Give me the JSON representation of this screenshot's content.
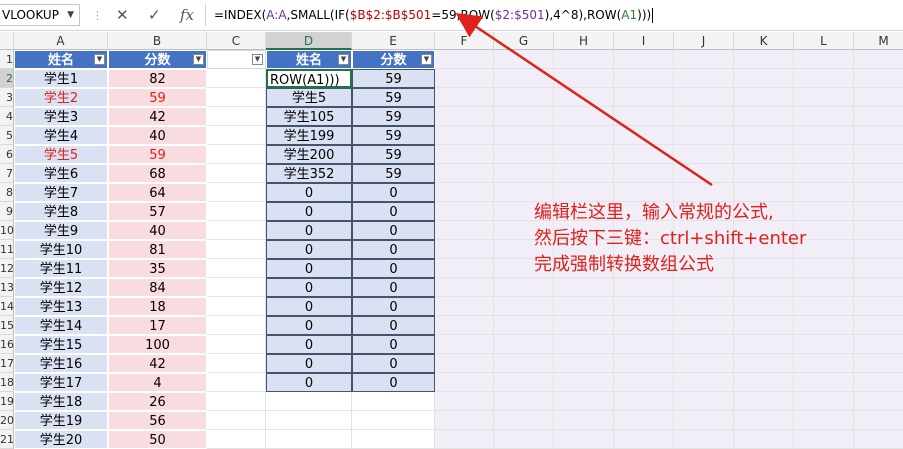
{
  "formula_bar": {
    "name_box": "VLOOKUP",
    "cancel_icon": "✕",
    "enter_icon": "✓",
    "fx_label": "fx",
    "formula_parts": [
      {
        "t": "=INDEX(",
        "c": ""
      },
      {
        "t": "A:A",
        "c": "r2"
      },
      {
        "t": ",SMALL(IF(",
        "c": ""
      },
      {
        "t": "$B$2:$B$501",
        "c": "r1"
      },
      {
        "t": "=59,ROW(",
        "c": ""
      },
      {
        "t": "$2:$501",
        "c": "r2"
      },
      {
        "t": "),4^8),ROW(",
        "c": ""
      },
      {
        "t": "A1",
        "c": "r3"
      },
      {
        "t": ")))",
        "c": ""
      }
    ]
  },
  "columns": [
    "A",
    "B",
    "C",
    "D",
    "E",
    "F",
    "G",
    "H",
    "I",
    "J",
    "K",
    "L",
    "M"
  ],
  "rows": [
    "1",
    "2",
    "3",
    "4",
    "5",
    "6",
    "7",
    "8",
    "9",
    "10",
    "11",
    "12",
    "13",
    "14",
    "15",
    "16",
    "17",
    "18",
    "19",
    "20",
    "21"
  ],
  "table_left": {
    "headers": [
      "姓名",
      "分数"
    ],
    "records": [
      [
        "学生1",
        "82"
      ],
      [
        "学生2",
        "59"
      ],
      [
        "学生3",
        "42"
      ],
      [
        "学生4",
        "40"
      ],
      [
        "学生5",
        "59"
      ],
      [
        "学生6",
        "68"
      ],
      [
        "学生7",
        "64"
      ],
      [
        "学生8",
        "57"
      ],
      [
        "学生9",
        "40"
      ],
      [
        "学生10",
        "81"
      ],
      [
        "学生11",
        "35"
      ],
      [
        "学生12",
        "84"
      ],
      [
        "学生13",
        "18"
      ],
      [
        "学生14",
        "17"
      ],
      [
        "学生15",
        "100"
      ],
      [
        "学生16",
        "42"
      ],
      [
        "学生17",
        "4"
      ],
      [
        "学生18",
        "26"
      ],
      [
        "学生19",
        "56"
      ],
      [
        "学生20",
        "50"
      ]
    ],
    "highlighted_rows": [
      1,
      4
    ]
  },
  "table_right": {
    "headers": [
      "姓名",
      "分数"
    ],
    "records": [
      [
        "ROW(A1)))",
        "59"
      ],
      [
        "学生5",
        "59"
      ],
      [
        "学生105",
        "59"
      ],
      [
        "学生199",
        "59"
      ],
      [
        "学生200",
        "59"
      ],
      [
        "学生352",
        "59"
      ],
      [
        "0",
        "0"
      ],
      [
        "0",
        "0"
      ],
      [
        "0",
        "0"
      ],
      [
        "0",
        "0"
      ],
      [
        "0",
        "0"
      ],
      [
        "0",
        "0"
      ],
      [
        "0",
        "0"
      ],
      [
        "0",
        "0"
      ],
      [
        "0",
        "0"
      ],
      [
        "0",
        "0"
      ],
      [
        "0",
        "0"
      ]
    ]
  },
  "annotation": {
    "lines": [
      "编辑栏这里，输入常规的公式,",
      "然后按下三键：ctrl+shift+enter",
      "完成强制转换数组公式"
    ],
    "color": "#e0201b"
  },
  "colors": {
    "header_blue": "#4472c4",
    "name_fill": "#d9e1f2",
    "score_fill": "#f8dce0",
    "excel_green": "#217346",
    "annotation_red": "#e0201b"
  }
}
